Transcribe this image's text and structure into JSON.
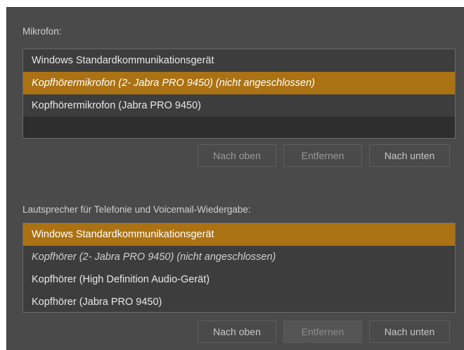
{
  "microphone": {
    "label": "Mikrofon:",
    "devices": [
      {
        "name": "Windows Standardkommunikationsgerät",
        "selected": false,
        "disconnected": false
      },
      {
        "name": "Kopfhörermikrofon (2- Jabra PRO 9450) (nicht angeschlossen)",
        "selected": true,
        "disconnected": true
      },
      {
        "name": "Kopfhörermikrofon (Jabra PRO 9450)",
        "selected": false,
        "disconnected": false
      }
    ],
    "buttons": {
      "up": "Nach oben",
      "remove": "Entfernen",
      "down": "Nach unten"
    }
  },
  "speaker": {
    "label": "Lautsprecher für Telefonie und Voicemail-Wiedergabe:",
    "devices": [
      {
        "name": "Windows Standardkommunikationsgerät",
        "selected": true,
        "disconnected": false
      },
      {
        "name": "Kopfhörer (2- Jabra PRO 9450) (nicht angeschlossen)",
        "selected": false,
        "disconnected": true
      },
      {
        "name": "Kopfhörer (High Definition Audio-Gerät)",
        "selected": false,
        "disconnected": false
      },
      {
        "name": "Kopfhörer (Jabra PRO 9450)",
        "selected": false,
        "disconnected": false
      }
    ],
    "buttons": {
      "up": "Nach oben",
      "remove": "Entfernen",
      "down": "Nach unten"
    }
  },
  "colors": {
    "panel_background": "#4a4a4a",
    "list_background": "#3d3d3d",
    "selection_accent": "#ab7213"
  }
}
